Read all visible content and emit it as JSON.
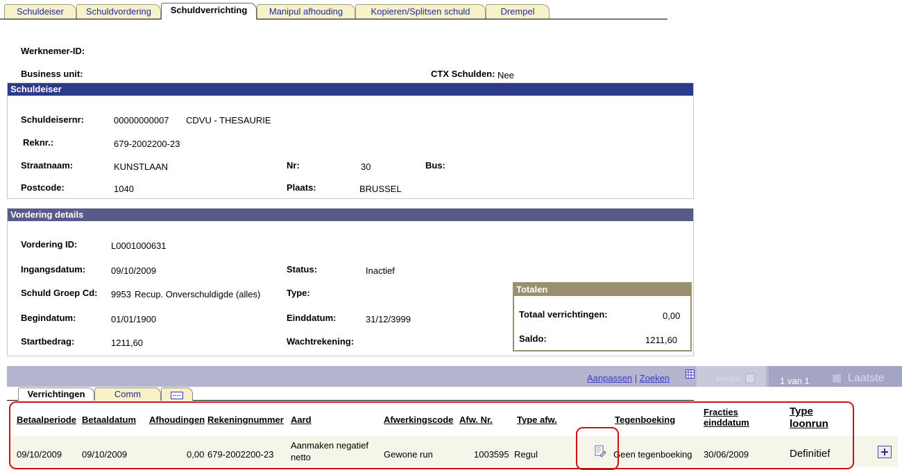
{
  "tabs": [
    {
      "label": "Schuldeiser"
    },
    {
      "label": "Schuldvordering"
    },
    {
      "label": "Schuldverrichting"
    },
    {
      "label": "Manipul afhouding"
    },
    {
      "label": "Kopieren/Splitsen schuld"
    },
    {
      "label": "Drempel"
    }
  ],
  "header": {
    "werknemer_label": "Werknemer-ID:",
    "business_unit_label": "Business unit:",
    "ctx_label": "CTX Schulden:",
    "ctx_value": "Nee"
  },
  "schuldeiser": {
    "title": "Schuldeiser",
    "nr_label": "Schuldeisernr:",
    "nr_value": "00000000007",
    "name_value": "CDVU - THESAURIE",
    "reknr_label": "Reknr.:",
    "reknr_value": "679-2002200-23",
    "straat_label": "Straatnaam:",
    "straat_value": "KUNSTLAAN",
    "nr2_label": "Nr:",
    "nr2_value": "30",
    "bus_label": "Bus:",
    "postcode_label": "Postcode:",
    "postcode_value": "1040",
    "plaats_label": "Plaats:",
    "plaats_value": "BRUSSEL"
  },
  "vordering": {
    "title": "Vordering details",
    "id_label": "Vordering ID:",
    "id_value": "L0001000631",
    "ingang_label": "Ingangsdatum:",
    "ingang_value": "09/10/2009",
    "status_label": "Status:",
    "status_value": "Inactief",
    "groep_label": "Schuld Groep Cd:",
    "groep_code": "9953",
    "groep_desc": "Recup. Onverschuldigde (alles)",
    "type_label": "Type:",
    "begin_label": "Begindatum:",
    "begin_value": "01/01/1900",
    "eind_label": "Einddatum:",
    "eind_value": "31/12/3999",
    "start_label": "Startbedrag:",
    "start_value": "1211,60",
    "wacht_label": "Wachtrekening:"
  },
  "totalen": {
    "title": "Totalen",
    "verr_label": "Totaal verrichtingen:",
    "verr_value": "0,00",
    "saldo_label": "Saldo:",
    "saldo_value": "1211,60"
  },
  "grid": {
    "aanpassen": "Aanpassen",
    "separator": "|",
    "zoeken": "Zoeken",
    "eerste": "Eerste",
    "range": "1 van 1",
    "laatste": "Laatste",
    "subtabs": [
      {
        "label": "Verrichtingen"
      },
      {
        "label": "Comm"
      }
    ],
    "columns": {
      "betaalperiode": "Betaalperiode",
      "betaaldatum": "Betaaldatum",
      "afhoudingen": "Afhoudingen",
      "rekeningnummer": "Rekeningnummer",
      "aard": "Aard",
      "afwerkingscode": "Afwerkingscode",
      "afw_nr": "Afw. Nr.",
      "type_afw": "Type afw.",
      "tegenboeking": "Tegenboeking",
      "fracties_1": "Fracties",
      "fracties_2": "einddatum",
      "type_loonrun_1": "Type",
      "type_loonrun_2": "loonrun"
    },
    "row": {
      "betaalperiode": "09/10/2009",
      "betaaldatum": "09/10/2009",
      "afhoudingen": "0,00",
      "rekeningnummer": "679-2002200-23",
      "aard_1": "Aanmaken negatief",
      "aard_2": "netto",
      "afwerkingscode": "Gewone run",
      "afw_nr": "1003595",
      "type_afw": "Regul",
      "tegenboeking": "Geen tegenboeking",
      "fracties": "30/06/2009",
      "type_loonrun": "Definitief"
    }
  }
}
